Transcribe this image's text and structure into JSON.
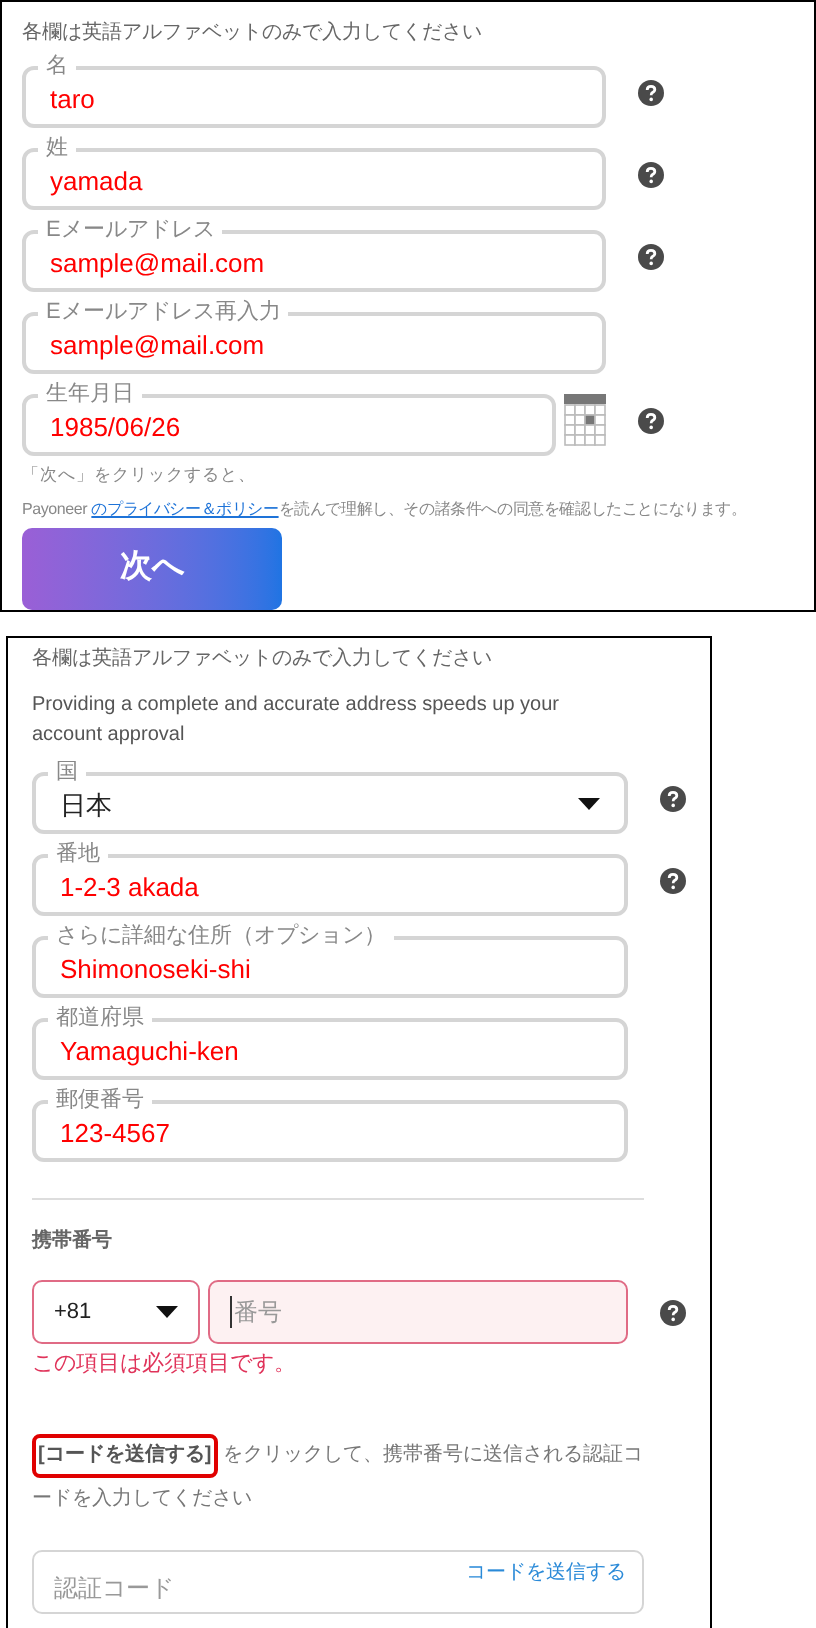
{
  "personal": {
    "instruction": "各欄は英語アルファベットのみで入力してください",
    "fields": [
      {
        "kind": "text",
        "label": "名",
        "value": "taro",
        "help": true
      },
      {
        "kind": "text",
        "label": "姓",
        "value": "yamada",
        "help": true
      },
      {
        "kind": "text",
        "label": "Eメールアドレス",
        "value": "sample@mail.com",
        "help": true
      },
      {
        "kind": "text",
        "label": "Eメールアドレス再入力",
        "value": "sample@mail.com",
        "help": false
      },
      {
        "kind": "date",
        "label": "生年月日",
        "value": "1985/06/26",
        "help": true
      }
    ],
    "note": "「次へ」をクリックすると、",
    "terms": {
      "prefix": "Payoneer",
      "link": "のプライバシー＆ポリシー",
      "suffix": "を読んで理解し、その諸条件への同意を確認したことになります。"
    },
    "next_button": "次へ"
  },
  "address": {
    "instruction": "各欄は英語アルファベットのみで入力してください",
    "hint": "Providing a complete and accurate address speeds up your account approval",
    "fields": [
      {
        "kind": "select",
        "label": "国",
        "value": "日本",
        "help": true
      },
      {
        "kind": "text",
        "label": "番地",
        "value": "1-2-3 akada",
        "help": true
      },
      {
        "kind": "text",
        "label": "さらに詳細な住所（オプション）",
        "value": "Shimonoseki-shi",
        "help": false
      },
      {
        "kind": "text",
        "label": "都道府県",
        "value": "Yamaguchi-ken",
        "help": false
      },
      {
        "kind": "text",
        "label": "郵便番号",
        "value": "123-4567",
        "help": false
      }
    ],
    "phone": {
      "heading": "携帯番号",
      "country_code": "+81",
      "placeholder": "番号",
      "error": "この項目は必須項目です。",
      "help": true
    },
    "code_note": {
      "highlight": "[コードを送信する]",
      "rest": "をクリックして、携帯番号に送信される認証コードを入力してください"
    },
    "code_field": {
      "placeholder": "認証コード",
      "send_link": "コードを送信する"
    }
  }
}
